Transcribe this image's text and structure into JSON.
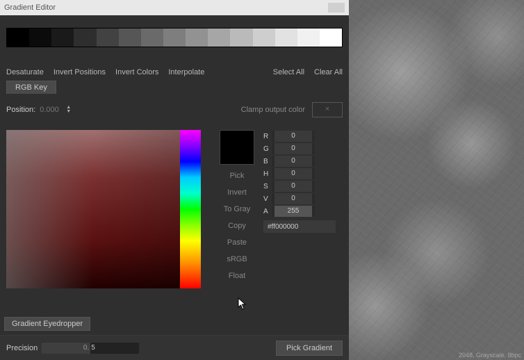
{
  "window": {
    "title": "Gradient Editor"
  },
  "gradient_stops": [
    "#000000",
    "#0b0b0b",
    "#1a1a1a",
    "#2e2e2e",
    "#424242",
    "#565656",
    "#6a6a6a",
    "#7e7e7e",
    "#929292",
    "#a6a6a6",
    "#bababa",
    "#cecece",
    "#e2e2e2",
    "#f1f1f1",
    "#ffffff"
  ],
  "actions": {
    "desaturate": "Desaturate",
    "invert_positions": "Invert Positions",
    "invert_colors": "Invert Colors",
    "interpolate": "Interpolate",
    "select_all": "Select All",
    "clear_all": "Clear All"
  },
  "tab": {
    "rgb_key": "RGB Key"
  },
  "position": {
    "label": "Position:",
    "value": "0.000"
  },
  "clamp": {
    "label": "Clamp output color",
    "btn": "×"
  },
  "swatch_actions": {
    "pick": "Pick",
    "invert": "Invert",
    "to_gray": "To Gray",
    "copy": "Copy",
    "paste": "Paste",
    "srgb": "sRGB",
    "float": "Float"
  },
  "channels": {
    "R": "0",
    "G": "0",
    "B": "0",
    "H": "0",
    "S": "0",
    "V": "0",
    "A": "255"
  },
  "hex": "#ff000000",
  "eyedropper": {
    "label": "Gradient Eyedropper"
  },
  "precision": {
    "label": "Precision",
    "left": "0.",
    "right": "5"
  },
  "pick_gradient": "Pick Gradient",
  "preview_footer": "2048, Grayscale, 8bpc"
}
